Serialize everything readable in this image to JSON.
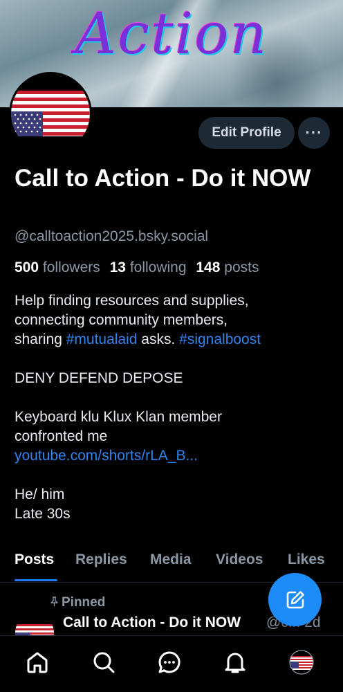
{
  "banner": {
    "title": "Action"
  },
  "profile": {
    "display_name": "Call to Action - Do it NOW",
    "handle": "@calltoaction2025.bsky.social",
    "edit_label": "Edit Profile",
    "more_label": "···",
    "stats": {
      "followers_count": "500",
      "followers_label": "followers",
      "following_count": "13",
      "following_label": "following",
      "posts_count": "148",
      "posts_label": "posts"
    },
    "bio": {
      "line1": "Help finding resources and supplies,",
      "line2": "connecting community members,",
      "line3_pre": "sharing ",
      "tag1": "#mutualaid",
      "line3_mid": " asks. ",
      "tag2": "#signalboost",
      "line4": "DENY DEFEND DEPOSE",
      "line5": "Keyboard klu Klux Klan member",
      "line6": "confronted me",
      "link": "youtube.com/shorts/rLA_B...",
      "line7": "He/ him",
      "line8": "Late 30s"
    }
  },
  "tabs": [
    "Posts",
    "Replies",
    "Media",
    "Videos",
    "Likes"
  ],
  "active_tab": "Posts",
  "feed": {
    "pinned_label": "Pinned",
    "post_author": "Call to Action - Do it NOW",
    "post_handle": "@c...",
    "post_time": "2d"
  },
  "colors": {
    "accent": "#1d8cf8",
    "link": "#2f84f0",
    "muted": "#8c97a5",
    "button_bg": "#1e2936"
  },
  "icons": {
    "fab": "compose-icon",
    "nav": [
      "home-icon",
      "search-icon",
      "chat-icon",
      "bell-icon",
      "profile-avatar"
    ]
  }
}
